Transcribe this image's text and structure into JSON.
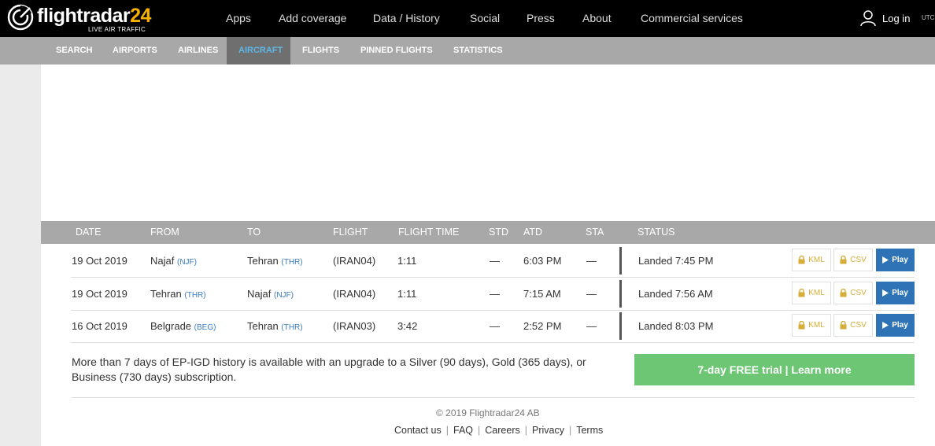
{
  "brand": {
    "name_a": "flightradar",
    "name_b": "24",
    "tagline": "LIVE AIR TRAFFIC"
  },
  "topnav": [
    "Apps",
    "Add coverage",
    "Data / History",
    "Social",
    "Press",
    "About",
    "Commercial services"
  ],
  "login_label": "Log in",
  "utc_label": "UTC",
  "subnav": [
    "SEARCH",
    "AIRPORTS",
    "AIRLINES",
    "AIRCRAFT",
    "FLIGHTS",
    "PINNED FLIGHTS",
    "STATISTICS"
  ],
  "active_subnav": "AIRCRAFT",
  "table": {
    "headers": [
      "DATE",
      "FROM",
      "TO",
      "FLIGHT",
      "FLIGHT TIME",
      "STD",
      "ATD",
      "STA",
      "STATUS"
    ],
    "rows": [
      {
        "date": "19 Oct 2019",
        "from": "Najaf",
        "from_code": "(NJF)",
        "to": "Tehran",
        "to_code": "(THR)",
        "flight": "(IRAN04)",
        "flight_time": "1:11",
        "std": "—",
        "atd": "6:03 PM",
        "sta": "—",
        "status": "Landed 7:45 PM"
      },
      {
        "date": "19 Oct 2019",
        "from": "Tehran",
        "from_code": "(THR)",
        "to": "Najaf",
        "to_code": "(NJF)",
        "flight": "(IRAN04)",
        "flight_time": "1:11",
        "std": "—",
        "atd": "7:15 AM",
        "sta": "—",
        "status": "Landed 7:56 AM"
      },
      {
        "date": "16 Oct 2019",
        "from": "Belgrade",
        "from_code": "(BEG)",
        "to": "Tehran",
        "to_code": "(THR)",
        "flight": "(IRAN03)",
        "flight_time": "3:42",
        "std": "—",
        "atd": "2:52 PM",
        "sta": "—",
        "status": "Landed 8:03 PM"
      }
    ],
    "kml_label": "KML",
    "csv_label": "CSV",
    "play_label": "Play"
  },
  "upgrade": {
    "text": "More than 7 days of EP-IGD history is available with an upgrade to a Silver (90 days), Gold (365 days), or Business (730 days) subscription.",
    "cta": "7-day FREE trial | Learn more"
  },
  "footer": {
    "copyright": "© 2019 Flightradar24 AB",
    "links": [
      "Contact us",
      "FAQ",
      "Careers",
      "Privacy",
      "Terms"
    ]
  },
  "colors": {
    "active_tab": "#5fb7e6",
    "play": "#2f73b7",
    "trial": "#6cc673",
    "brand_accent": "#f5b100"
  }
}
